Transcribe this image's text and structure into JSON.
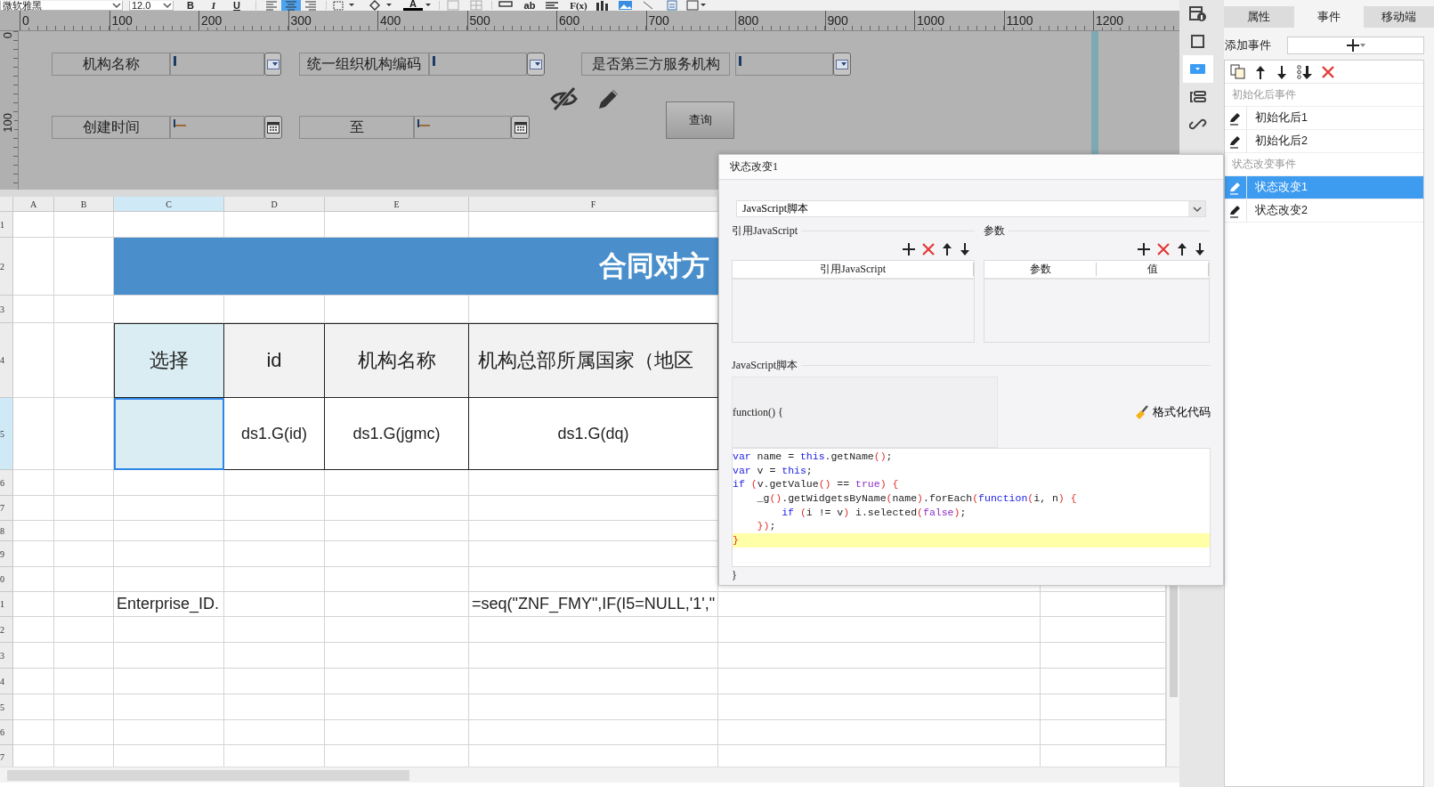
{
  "toolbar": {
    "font": "微软雅黑",
    "size": "12.0",
    "format_buttons": [
      {
        "label": "B",
        "kind": "bold"
      },
      {
        "label": "I",
        "kind": "italic"
      },
      {
        "label": "U",
        "kind": "underline"
      }
    ],
    "align_buttons": [
      {
        "kind": "left",
        "selected": false
      },
      {
        "kind": "center",
        "selected": true
      },
      {
        "kind": "right",
        "selected": false
      }
    ],
    "font_color_button": "A",
    "text_button": "ab",
    "formula_button": "F(x)"
  },
  "ruler": {
    "x_labels": [
      "0",
      "100",
      "200",
      "300",
      "400",
      "500",
      "600",
      "700",
      "800",
      "900",
      "1000",
      "1100",
      "1200"
    ],
    "y_labels": [
      "0",
      "100"
    ]
  },
  "form": {
    "fields": [
      {
        "label": "机构名称",
        "kind": "dropdown"
      },
      {
        "label": "统一组织机构编码",
        "kind": "dropdown"
      },
      {
        "label": "是否第三方服务机构",
        "kind": "dropdown"
      },
      {
        "label": "创建时间",
        "kind": "date"
      },
      {
        "label": "至",
        "kind": "date"
      }
    ],
    "query_button": "查询"
  },
  "sheet": {
    "columns": [
      {
        "label": "A",
        "selected": false
      },
      {
        "label": "B",
        "selected": false
      },
      {
        "label": "C",
        "selected": true
      },
      {
        "label": "D",
        "selected": false
      },
      {
        "label": "E",
        "selected": false
      },
      {
        "label": "F",
        "selected": false
      }
    ],
    "rows": [
      {
        "label": "1",
        "selected": false
      },
      {
        "label": "2",
        "selected": false
      },
      {
        "label": "3",
        "selected": false
      },
      {
        "label": "4",
        "selected": false
      },
      {
        "label": "5",
        "selected": true
      },
      {
        "label": "6",
        "selected": false
      },
      {
        "label": "7",
        "selected": false
      },
      {
        "label": "8",
        "selected": false
      },
      {
        "label": "9",
        "selected": false
      },
      {
        "label": "0",
        "selected": false
      },
      {
        "label": "1",
        "selected": false
      },
      {
        "label": "2",
        "selected": false
      },
      {
        "label": "3",
        "selected": false
      },
      {
        "label": "4",
        "selected": false
      },
      {
        "label": "5",
        "selected": false
      },
      {
        "label": "6",
        "selected": false
      },
      {
        "label": "7",
        "selected": false
      }
    ],
    "title": "合同对方",
    "header_cells": [
      "选择",
      "id",
      "机构名称",
      "机构总部所属国家（地区"
    ],
    "data_cells": [
      {
        "selected": true
      },
      {
        "text": "ds1.G(id)",
        "selected": false
      },
      {
        "text": "ds1.G(jgmc)",
        "selected": false
      },
      {
        "text": "ds1.G(dq)",
        "selected": false
      }
    ],
    "footer_cells": [
      "Enterprise_ID.",
      "=seq(\"ZNF_FMY\",IF(I5=NULL,'1',\""
    ]
  },
  "side_tools": [
    {
      "kind": "info",
      "selected": false
    },
    {
      "kind": "frame",
      "selected": false
    },
    {
      "kind": "dropdown",
      "selected": true
    },
    {
      "kind": "layout",
      "selected": false
    },
    {
      "kind": "link",
      "selected": false
    }
  ],
  "panel": {
    "tabs": [
      {
        "label": "属性",
        "selected": false
      },
      {
        "label": "事件",
        "selected": true
      },
      {
        "label": "移动端",
        "selected": false
      }
    ],
    "add_event_label": "添加事件",
    "groups": [
      {
        "title": "初始化后事件",
        "items": [
          {
            "label": "初始化后1",
            "selected": false
          },
          {
            "label": "初始化后2",
            "selected": false
          }
        ]
      },
      {
        "title": "状态改变事件",
        "items": [
          {
            "label": "状态改变1",
            "selected": true
          },
          {
            "label": "状态改变2",
            "selected": false
          }
        ]
      }
    ]
  },
  "dialog": {
    "title": "状态改变1",
    "script_type": "JavaScript脚本",
    "ref_section": {
      "title": "引用JavaScript",
      "columns": [
        "引用JavaScript"
      ]
    },
    "param_section": {
      "title": "参数",
      "columns": [
        "参数",
        "值"
      ]
    },
    "script_section": {
      "title": "JavaScript脚本",
      "header": "function() {",
      "format_button": "格式化代码",
      "footer": "}",
      "lines": [
        {
          "highlighted": false,
          "tokens": [
            {
              "kind": "keyword",
              "text": "var"
            },
            {
              "kind": "plain",
              "text": " name = "
            },
            {
              "kind": "keyword",
              "text": "this"
            },
            {
              "kind": "plain",
              "text": ".getName"
            },
            {
              "kind": "punct",
              "text": "()"
            },
            {
              "kind": "plain",
              "text": ";"
            }
          ]
        },
        {
          "highlighted": false,
          "tokens": [
            {
              "kind": "keyword",
              "text": "var"
            },
            {
              "kind": "plain",
              "text": " v = "
            },
            {
              "kind": "keyword",
              "text": "this"
            },
            {
              "kind": "plain",
              "text": ";"
            }
          ]
        },
        {
          "highlighted": false,
          "tokens": [
            {
              "kind": "keyword",
              "text": "if"
            },
            {
              "kind": "punct",
              "text": " ("
            },
            {
              "kind": "plain",
              "text": "v.getValue"
            },
            {
              "kind": "punct",
              "text": "()"
            },
            {
              "kind": "plain",
              "text": " == "
            },
            {
              "kind": "literal",
              "text": "true"
            },
            {
              "kind": "punct",
              "text": ") {"
            }
          ]
        },
        {
          "highlighted": false,
          "tokens": [
            {
              "kind": "plain",
              "text": "    _g"
            },
            {
              "kind": "punct",
              "text": "()"
            },
            {
              "kind": "plain",
              "text": ".getWidgetsByName"
            },
            {
              "kind": "punct",
              "text": "("
            },
            {
              "kind": "plain",
              "text": "name"
            },
            {
              "kind": "punct",
              "text": ")"
            },
            {
              "kind": "plain",
              "text": ".forEach"
            },
            {
              "kind": "punct",
              "text": "("
            },
            {
              "kind": "keyword",
              "text": "function"
            },
            {
              "kind": "punct",
              "text": "("
            },
            {
              "kind": "plain",
              "text": "i, n"
            },
            {
              "kind": "punct",
              "text": ") {"
            }
          ]
        },
        {
          "highlighted": false,
          "tokens": [
            {
              "kind": "keyword",
              "text": "        if"
            },
            {
              "kind": "punct",
              "text": " ("
            },
            {
              "kind": "plain",
              "text": "i != v"
            },
            {
              "kind": "punct",
              "text": ")"
            },
            {
              "kind": "plain",
              "text": " i.selected"
            },
            {
              "kind": "punct",
              "text": "("
            },
            {
              "kind": "literal",
              "text": "false"
            },
            {
              "kind": "punct",
              "text": ")"
            },
            {
              "kind": "plain",
              "text": ";"
            }
          ]
        },
        {
          "highlighted": false,
          "tokens": [
            {
              "kind": "punct",
              "text": "    })"
            },
            {
              "kind": "plain",
              "text": ";"
            }
          ]
        },
        {
          "highlighted": true,
          "tokens": [
            {
              "kind": "punct",
              "text": "}"
            }
          ]
        }
      ]
    }
  }
}
